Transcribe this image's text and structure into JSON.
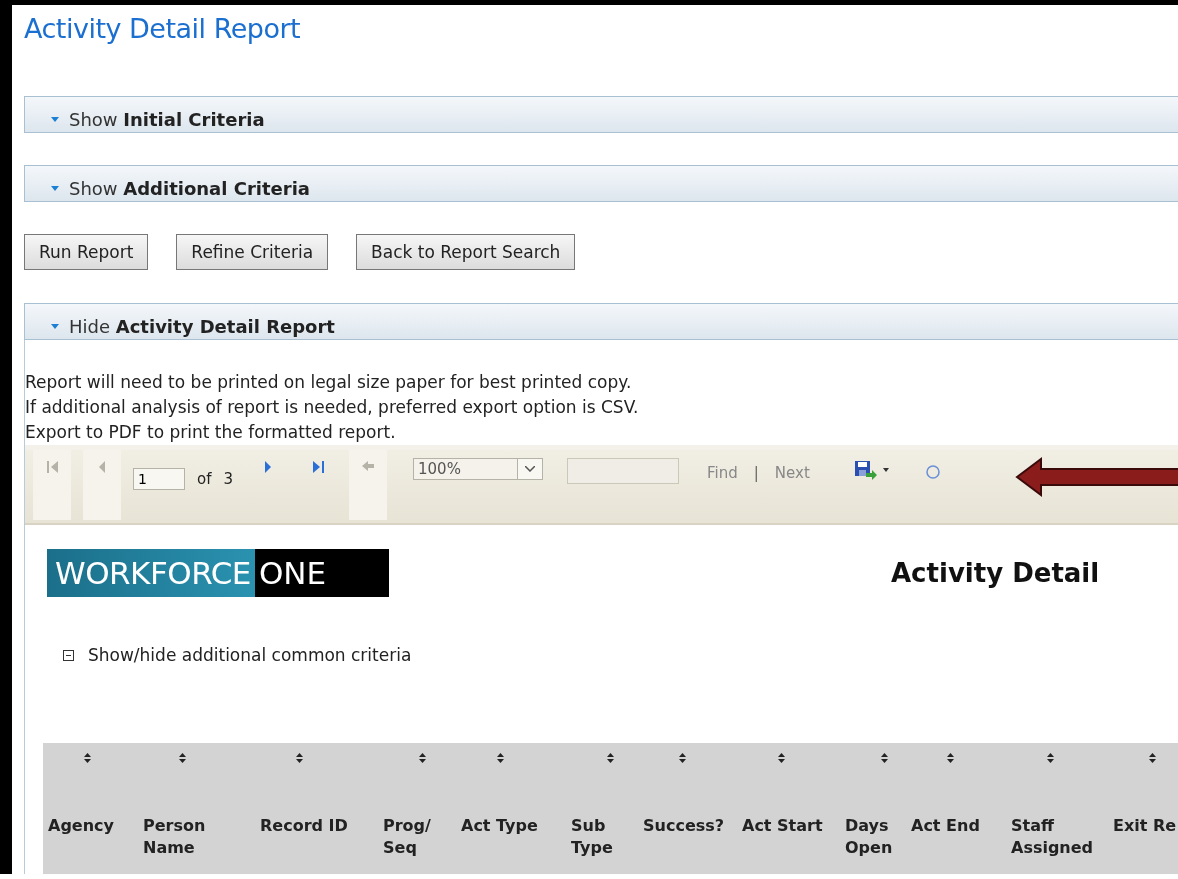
{
  "page_title": "Activity Detail Report",
  "criteria_sections": [
    {
      "label": "Show **Initial Criteria**"
    },
    {
      "label": "Show **Additional Criteria**"
    }
  ],
  "buttons": [
    "Run Report",
    "Refine Criteria",
    "Back to Report Search"
  ],
  "report_section": {
    "label": "Hide **Activity Detail Report**"
  },
  "notes": [
    "Report will need to be printed on legal size paper for best printed copy.",
    "If additional analysis of report is needed, preferred export option is CSV.",
    "Export to PDF to print the formatted report."
  ],
  "toolbar": {
    "page": "1",
    "of_label": "of",
    "page_count": "3",
    "zoom": "100%",
    "find_label": "Find",
    "separator": "|",
    "next_label": "Next",
    "nav": [
      {
        "kind": "first",
        "disabled": true
      },
      {
        "kind": "prev",
        "disabled": true
      },
      {
        "kind": "next",
        "disabled": false
      },
      {
        "kind": "last",
        "disabled": false
      }
    ],
    "back_disabled": true
  },
  "report": {
    "logo": [
      "WORKFORCE",
      "ONE"
    ],
    "title": "Activity Detail",
    "toggle_label": "Show/hide additional common criteria",
    "columns": [
      "Agency",
      "Person Name",
      "Record ID",
      "Prog/ Seq",
      "Act Type",
      "Sub Type",
      "Success?",
      "Act Start",
      "Days Open",
      "Act End",
      "Staff Assigned",
      "Exit Re"
    ]
  }
}
